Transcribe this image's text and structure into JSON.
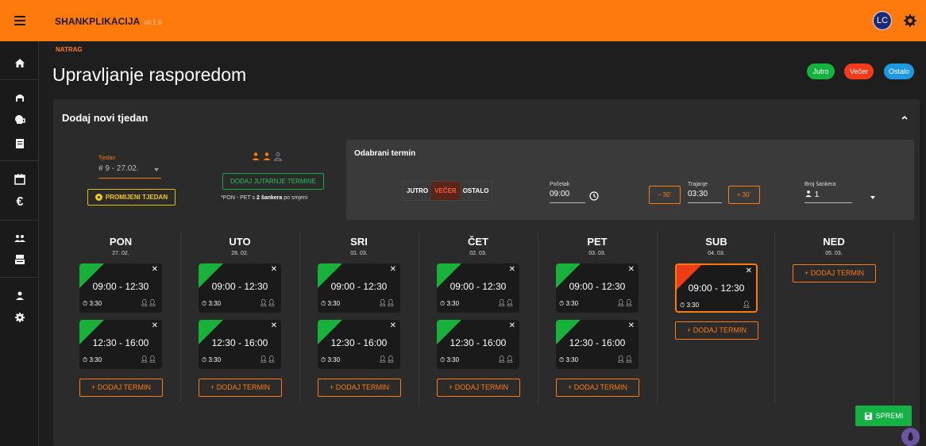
{
  "app": {
    "brand": "SHANKPLIKACIJA",
    "version": "v0.1.0",
    "avatar_initials": "LC"
  },
  "sidebar": {
    "icons": [
      "menu-icon",
      "home-icon",
      "bar-icon",
      "beer-icon",
      "receipt-icon",
      "calendar-icon",
      "euro-icon",
      "group-icon",
      "register-icon",
      "person-icon",
      "settings-icon"
    ]
  },
  "header": {
    "back_label": "NATRAG",
    "title": "Upravljanje rasporedom"
  },
  "legend": [
    {
      "label": "Jutro",
      "color": "#13b33d"
    },
    {
      "label": "Večer",
      "color": "#f23a1c"
    },
    {
      "label": "Ostalo",
      "color": "#1c99e0"
    }
  ],
  "panel": {
    "title": "Dodaj novi tjedan",
    "week": {
      "label": "Tjedan",
      "value": "# 9 - 27.02.",
      "change_button": "PROMIJENI TJEDAN"
    },
    "morning": {
      "button": "DODAJ JUTARNJE TERMINE",
      "note_prefix": "*PON - PET s ",
      "note_bold": "2 šankera",
      "note_suffix": " po smjeni"
    },
    "selected_term": {
      "title": "Odabrani termin",
      "segments": [
        "JUTRO",
        "VEČER",
        "OSTALO"
      ],
      "active_segment": "VEČER",
      "start_label": "Početak",
      "start_value": "09:00",
      "duration_label": "Trajanje",
      "duration_value": "03:30",
      "minus_label": "− 30´",
      "plus_label": "+ 30´",
      "count_label": "Broj šankera",
      "count_value": "1"
    }
  },
  "days": [
    {
      "name": "PON",
      "date": "27. 02.",
      "shifts": [
        {
          "time": "09:00 - 12:30",
          "duration": "3:30",
          "crew": 2,
          "type": "jutro"
        },
        {
          "time": "12:30 - 16:00",
          "duration": "3:30",
          "crew": 2,
          "type": "jutro"
        }
      ]
    },
    {
      "name": "UTO",
      "date": "28. 02.",
      "shifts": [
        {
          "time": "09:00 - 12:30",
          "duration": "3:30",
          "crew": 2,
          "type": "jutro"
        },
        {
          "time": "12:30 - 16:00",
          "duration": "3:30",
          "crew": 2,
          "type": "jutro"
        }
      ]
    },
    {
      "name": "SRI",
      "date": "01. 03.",
      "shifts": [
        {
          "time": "09:00 - 12:30",
          "duration": "3:30",
          "crew": 2,
          "type": "jutro"
        },
        {
          "time": "12:30 - 16:00",
          "duration": "3:30",
          "crew": 2,
          "type": "jutro"
        }
      ]
    },
    {
      "name": "ČET",
      "date": "02. 03.",
      "shifts": [
        {
          "time": "09:00 - 12:30",
          "duration": "3:30",
          "crew": 2,
          "type": "jutro"
        },
        {
          "time": "12:30 - 16:00",
          "duration": "3:30",
          "crew": 2,
          "type": "jutro"
        }
      ]
    },
    {
      "name": "PET",
      "date": "03. 03.",
      "shifts": [
        {
          "time": "09:00 - 12:30",
          "duration": "3:30",
          "crew": 2,
          "type": "jutro"
        },
        {
          "time": "12:30 - 16:00",
          "duration": "3:30",
          "crew": 2,
          "type": "jutro"
        }
      ]
    },
    {
      "name": "SUB",
      "date": "04. 03.",
      "shifts": [
        {
          "time": "09:00 - 12:30",
          "duration": "3:30",
          "crew": 1,
          "type": "vecer",
          "selected": true
        }
      ]
    },
    {
      "name": "NED",
      "date": "05. 03.",
      "shifts": []
    }
  ],
  "add_term_label": "+ DODAJ TERMIN",
  "save_label": "SPREMI"
}
